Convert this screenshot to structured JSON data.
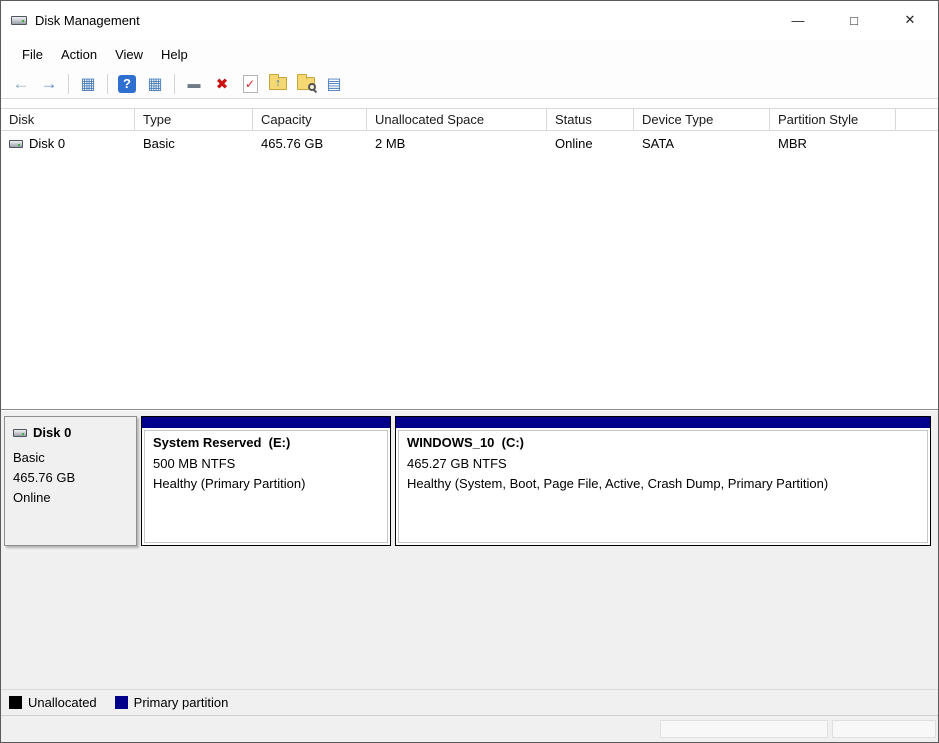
{
  "window": {
    "title": "Disk Management",
    "controls": {
      "minimize": "—",
      "maximize": "□",
      "close": "✕"
    }
  },
  "menu": {
    "items": [
      {
        "label": "File"
      },
      {
        "label": "Action"
      },
      {
        "label": "View"
      },
      {
        "label": "Help"
      }
    ]
  },
  "toolbar": {
    "icons": [
      {
        "name": "back",
        "glyph": "←"
      },
      {
        "name": "forward",
        "glyph": "→"
      },
      {
        "name": "show-console-tree",
        "glyph": "▦"
      },
      {
        "name": "help",
        "glyph": "?"
      },
      {
        "name": "show-action-pane",
        "glyph": "▦"
      },
      {
        "name": "command",
        "glyph": "▬"
      },
      {
        "name": "delete-volume",
        "glyph": "✖"
      },
      {
        "name": "set-active",
        "glyph": "✓"
      },
      {
        "name": "open",
        "glyph": "↑"
      },
      {
        "name": "explore",
        "glyph": ""
      },
      {
        "name": "properties",
        "glyph": "▤"
      }
    ]
  },
  "table": {
    "columns": [
      "Disk",
      "Type",
      "Capacity",
      "Unallocated Space",
      "Status",
      "Device Type",
      "Partition Style"
    ],
    "rows": [
      [
        "Disk 0",
        "Basic",
        "465.76 GB",
        "2 MB",
        "Online",
        "SATA",
        "MBR"
      ]
    ]
  },
  "graph": {
    "disk": {
      "name": "Disk 0",
      "type": "Basic",
      "capacity": "465.76 GB",
      "status": "Online"
    },
    "partitions": [
      {
        "label": "System Reserved  (E:)",
        "size": "500 MB NTFS",
        "status": "Healthy (Primary Partition)",
        "color": "#00008b"
      },
      {
        "label": "WINDOWS_10  (C:)",
        "size": "465.27 GB NTFS",
        "status": "Healthy (System, Boot, Page File, Active, Crash Dump, Primary Partition)",
        "color": "#00008b"
      }
    ]
  },
  "legend": {
    "items": [
      {
        "label": "Unallocated",
        "color": "#000000"
      },
      {
        "label": "Primary partition",
        "color": "#00008b"
      }
    ]
  }
}
